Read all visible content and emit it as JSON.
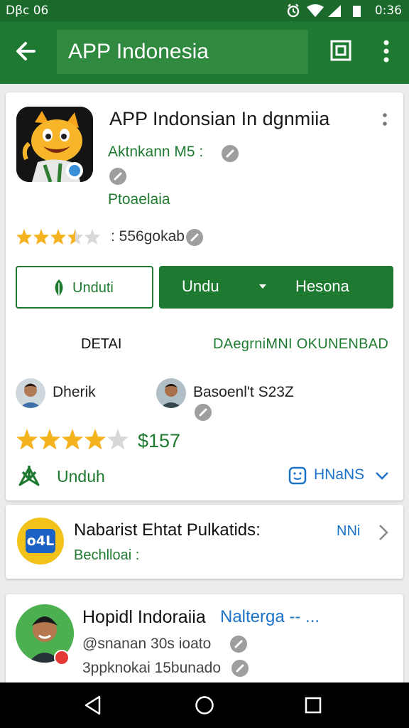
{
  "status_bar": {
    "left_text": "Dβc 06",
    "time": "0:36"
  },
  "app_bar": {
    "search_text": "APP Indonesia"
  },
  "app_card": {
    "title": "APP Indonsian In dgnmiia",
    "developer": "Aktnkann M5 :",
    "category": "Ptoaelaia",
    "rating_count": ": 556gokab",
    "rating_stars": 3.5,
    "install_button": "Unduti",
    "primary_left": "Undu",
    "primary_right": "Hesona",
    "tab_detail": "DETAI",
    "tab_other": "DAegrniMNI OKUNENBAD",
    "people": [
      {
        "name": "Dherik"
      },
      {
        "name": "Basoenl't S23Z"
      }
    ],
    "score_stars": 4,
    "price": "$157",
    "download_label": "Unduh",
    "more_label": "HNaNS"
  },
  "news_card": {
    "title": "Nabarist Ehtat Pulkatids:",
    "subtitle": "Bechlloai :",
    "link": "NNi",
    "icon_text": "o4L"
  },
  "profile_card": {
    "name": "Hopidl Indoraiia",
    "link": "Nalterga -- ...",
    "line1": "@snanan 30s ioato",
    "line2": "3ppknokai 15bunado"
  },
  "colors": {
    "primary_green": "#1f7a31",
    "statusbar_green": "#1b6a2b",
    "link_blue": "#1a73c8",
    "star": "#f5b31f"
  }
}
